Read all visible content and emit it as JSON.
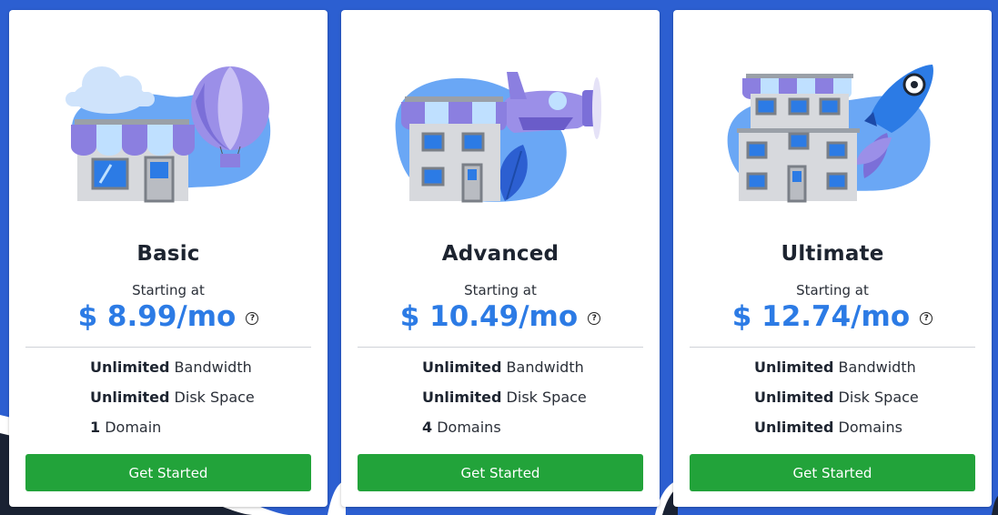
{
  "plans": [
    {
      "name": "Basic",
      "starting_label": "Starting at",
      "price": "$ 8.99/mo",
      "help_icon": "?",
      "features": [
        {
          "bold": "Unlimited",
          "text": " Bandwidth"
        },
        {
          "bold": "Unlimited",
          "text": " Disk Space"
        },
        {
          "bold": "1",
          "text": " Domain"
        }
      ],
      "button_label": "Get Started",
      "illustration": "storefront-balloon-cloud"
    },
    {
      "name": "Advanced",
      "starting_label": "Starting at",
      "price": "$ 10.49/mo",
      "help_icon": "?",
      "features": [
        {
          "bold": "Unlimited",
          "text": " Bandwidth"
        },
        {
          "bold": "Unlimited",
          "text": " Disk Space"
        },
        {
          "bold": "4",
          "text": " Domains"
        }
      ],
      "button_label": "Get Started",
      "illustration": "building-airplane-leaf"
    },
    {
      "name": "Ultimate",
      "starting_label": "Starting at",
      "price": "$ 12.74/mo",
      "help_icon": "?",
      "features": [
        {
          "bold": "Unlimited",
          "text": " Bandwidth"
        },
        {
          "bold": "Unlimited",
          "text": " Disk Space"
        },
        {
          "bold": "Unlimited",
          "text": " Domains"
        }
      ],
      "button_label": "Get Started",
      "illustration": "office-building-rocket"
    }
  ],
  "colors": {
    "background": "#2c5fd1",
    "price": "#2c7be5",
    "button": "#22a33a",
    "awning_purple": "#8b7fe0",
    "awning_light": "#bfe0ff",
    "blob": "#6aa7f5"
  }
}
